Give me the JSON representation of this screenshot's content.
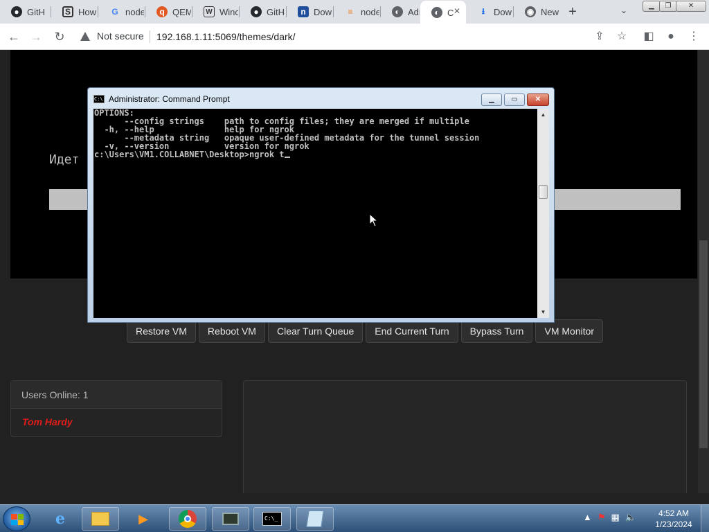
{
  "browser": {
    "tabs": [
      {
        "label": "GitH",
        "icon": "github-icon"
      },
      {
        "label": "How",
        "icon": "stackexchange-icon"
      },
      {
        "label": "node",
        "icon": "google-icon"
      },
      {
        "label": "QEM",
        "icon": "qemu-icon"
      },
      {
        "label": "Winc",
        "icon": "wikipedia-icon"
      },
      {
        "label": "GitH",
        "icon": "github-icon"
      },
      {
        "label": "Dow",
        "icon": "n-icon"
      },
      {
        "label": "node",
        "icon": "stackoverflow-icon"
      },
      {
        "label": "Adm",
        "icon": "globe-icon"
      },
      {
        "label": "C",
        "icon": "globe-icon",
        "active": true
      },
      {
        "label": "Dow",
        "icon": "download-icon"
      },
      {
        "label": "New",
        "icon": "chrome-icon"
      }
    ],
    "security_label": "Not secure",
    "url": "192.168.1.11:5069/themes/dark/"
  },
  "vm": {
    "screen_text": "Идет",
    "buttons": [
      "Restore VM",
      "Reboot VM",
      "Clear Turn Queue",
      "End Current Turn",
      "Bypass Turn",
      "VM Monitor"
    ]
  },
  "users": {
    "header": "Users Online: 1",
    "list": [
      "Tom Hardy"
    ]
  },
  "cmd": {
    "title": "Administrator: Command Prompt",
    "icon_text": "C:\\",
    "lines": [
      "OPTIONS:",
      "      --config strings    path to config files; they are merged if multiple",
      "  -h, --help              help for ngrok",
      "      --metadata string   opaque user-defined metadata for the tunnel session",
      "  -v, --version           version for ngrok",
      "",
      "c:\\Users\\VM1.COLLABNET\\Desktop>ngrok t"
    ]
  },
  "taskbar": {
    "apps": [
      "ie-icon",
      "explorer-icon",
      "media-player-icon",
      "chrome-icon",
      "monitor-app-icon",
      "cmd-icon",
      "notepad-icon"
    ],
    "time": "4:52 AM",
    "date": "1/23/2024"
  },
  "colors": {
    "page_bg": "#212121",
    "user_name": "#e31b1b",
    "taskbar": "#2c4f77"
  }
}
